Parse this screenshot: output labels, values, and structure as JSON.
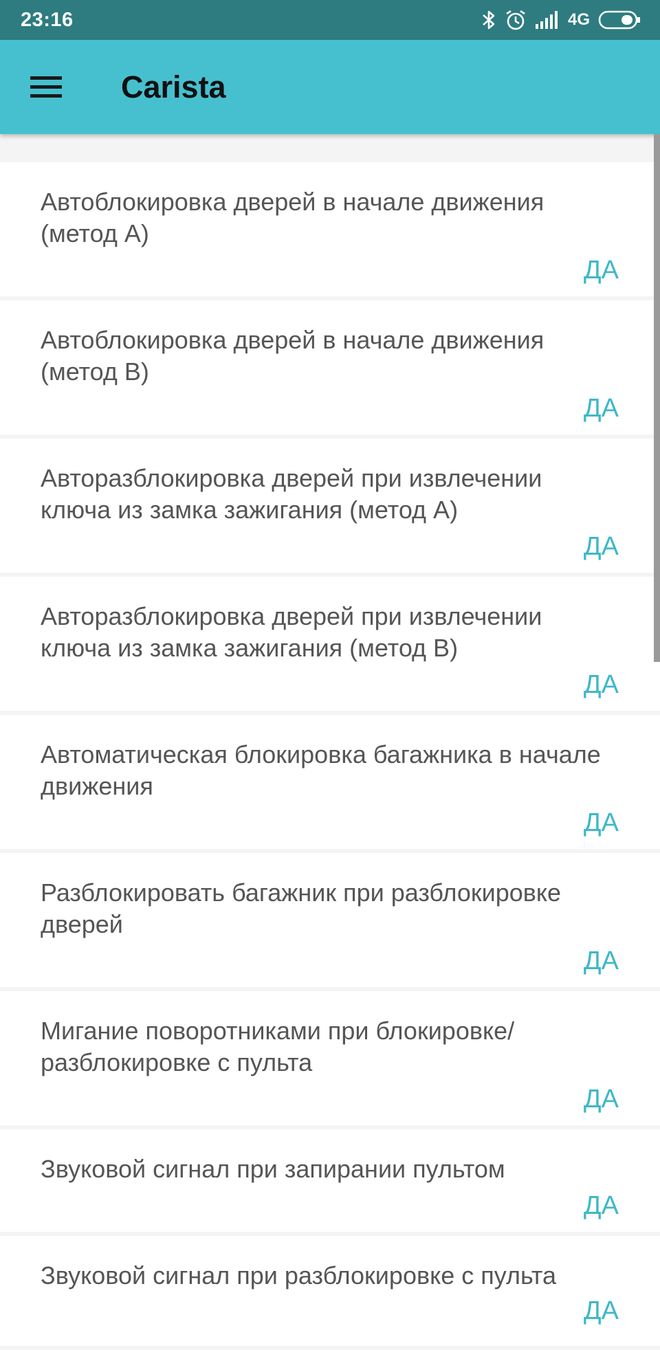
{
  "status_bar": {
    "time": "23:16",
    "network": "4G",
    "icons": [
      "bluetooth-icon",
      "alarm-icon",
      "signal-icon",
      "battery-icon"
    ]
  },
  "app_bar": {
    "title": "Carista",
    "menu_icon": "hamburger-menu-icon"
  },
  "colors": {
    "status_bar": "#2e7c80",
    "app_bar": "#46c0cf",
    "accent": "#3fb8c8",
    "text": "#555555"
  },
  "settings": [
    {
      "label": "Автоблокировка дверей в начале движения (метод A)",
      "value": "ДА"
    },
    {
      "label": "Автоблокировка дверей в начале движения (метод B)",
      "value": "ДА"
    },
    {
      "label": "Авторазблокировка дверей при извлечении ключа из замка зажигания (метод A)",
      "value": "ДА"
    },
    {
      "label": "Авторазблокировка дверей при извлечении ключа из замка зажигания (метод B)",
      "value": "ДА"
    },
    {
      "label": "Автоматическая блокировка багажника в начале движения",
      "value": "ДА"
    },
    {
      "label": "Разблокировать багажник при разблокировке дверей",
      "value": "ДА"
    },
    {
      "label": "Мигание поворотниками при блокировке/ разблокировке с пульта",
      "value": "ДА"
    },
    {
      "label": "Звуковой сигнал при запирании пультом",
      "value": "ДА"
    },
    {
      "label": "Звуковой сигнал при разблокировке с пульта",
      "value": "ДА"
    }
  ]
}
